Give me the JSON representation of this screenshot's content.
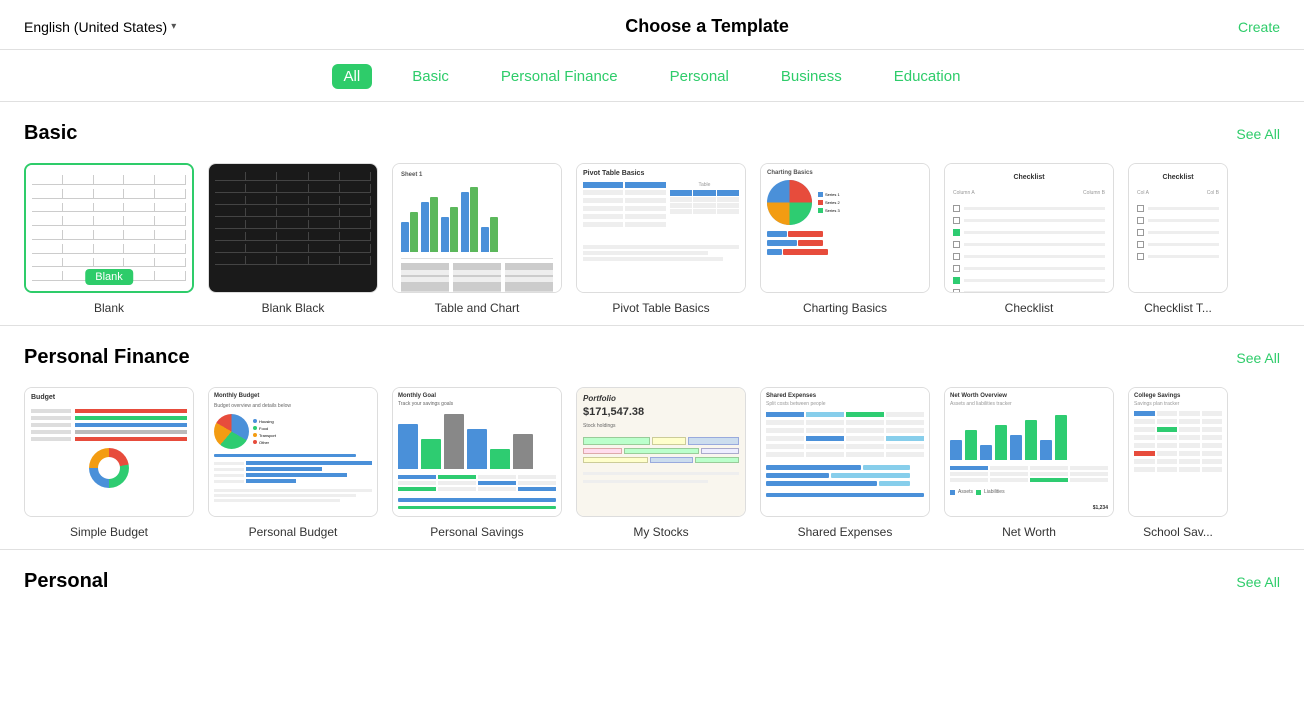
{
  "header": {
    "lang_selector": "English (United States)",
    "title": "Choose a Template",
    "create_button": "Create"
  },
  "tabs": [
    {
      "id": "all",
      "label": "All",
      "active": true
    },
    {
      "id": "basic",
      "label": "Basic",
      "active": false
    },
    {
      "id": "personal-finance",
      "label": "Personal Finance",
      "active": false
    },
    {
      "id": "personal",
      "label": "Personal",
      "active": false
    },
    {
      "id": "business",
      "label": "Business",
      "active": false
    },
    {
      "id": "education",
      "label": "Education",
      "active": false
    }
  ],
  "sections": [
    {
      "id": "basic",
      "title": "Basic",
      "see_all": "See All",
      "templates": [
        {
          "id": "blank",
          "label": "Blank",
          "badge": "Blank",
          "selected": true
        },
        {
          "id": "blank-black",
          "label": "Blank Black"
        },
        {
          "id": "table-chart",
          "label": "Table and Chart"
        },
        {
          "id": "pivot-table",
          "label": "Pivot Table Basics"
        },
        {
          "id": "charting-basics",
          "label": "Charting Basics"
        },
        {
          "id": "checklist",
          "label": "Checklist"
        },
        {
          "id": "checklist2",
          "label": "Checklist"
        }
      ]
    },
    {
      "id": "personal-finance",
      "title": "Personal Finance",
      "see_all": "See All",
      "templates": [
        {
          "id": "simple-budget",
          "label": "Simple Budget"
        },
        {
          "id": "personal-budget",
          "label": "Personal Budget"
        },
        {
          "id": "personal-savings",
          "label": "Personal Savings"
        },
        {
          "id": "my-stocks",
          "label": "My Stocks"
        },
        {
          "id": "shared-expenses",
          "label": "Shared Expenses"
        },
        {
          "id": "net-worth",
          "label": "Net Worth"
        },
        {
          "id": "school-savings",
          "label": "School Sav..."
        }
      ]
    },
    {
      "id": "personal",
      "title": "Personal",
      "see_all": "See All"
    }
  ],
  "colors": {
    "accent": "#2ecc6a",
    "blue": "#4a90d9",
    "green": "#2ecc71",
    "red": "#e74c3c",
    "orange": "#e67e22"
  }
}
